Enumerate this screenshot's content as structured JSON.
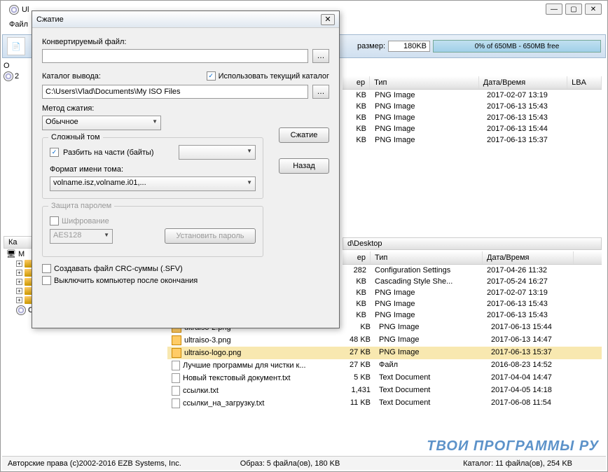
{
  "main_window": {
    "title_prefix": "Ul",
    "menu_file": "Файл",
    "size_label": "размер:",
    "size_value": "180KB",
    "progress_text": "0% of 650MB - 650MB free"
  },
  "upper_list": {
    "hdr_size": "ер",
    "hdr_type": "Тип",
    "hdr_date": "Дата/Время",
    "hdr_lba": "LBA",
    "rows": [
      {
        "size": "KB",
        "type": "PNG Image",
        "date": "2017-02-07 13:19"
      },
      {
        "size": "KB",
        "type": "PNG Image",
        "date": "2017-06-13 15:43"
      },
      {
        "size": "KB",
        "type": "PNG Image",
        "date": "2017-06-13 15:43"
      },
      {
        "size": "KB",
        "type": "PNG Image",
        "date": "2017-06-13 15:44"
      },
      {
        "size": "KB",
        "type": "PNG Image",
        "date": "2017-06-13 15:37"
      }
    ]
  },
  "path_bar": "d\\Desktop",
  "lower_list": {
    "hdr_size": "ер",
    "hdr_type": "Тип",
    "hdr_date": "Дата/Время",
    "rows": [
      {
        "size": "282",
        "type": "Configuration Settings",
        "date": "2017-04-26 11:32"
      },
      {
        "size": "KB",
        "type": "Cascading Style She...",
        "date": "2017-05-24 16:27"
      },
      {
        "size": "KB",
        "type": "PNG Image",
        "date": "2017-02-07 13:19"
      },
      {
        "size": "KB",
        "type": "PNG Image",
        "date": "2017-06-13 15:43"
      },
      {
        "size": "KB",
        "type": "PNG Image",
        "date": "2017-06-13 15:43"
      }
    ]
  },
  "lower_list2": {
    "rows": [
      {
        "name": "ultraiso-2.png",
        "size": "KB",
        "type": "PNG Image",
        "date": "2017-06-13 15:44"
      },
      {
        "name": "ultraiso-3.png",
        "size": "48 KB",
        "type": "PNG Image",
        "date": "2017-06-13 14:47"
      },
      {
        "name": "ultraiso-logo.png",
        "size": "27 KB",
        "type": "PNG Image",
        "date": "2017-06-13 15:37"
      },
      {
        "name": "Лучшие программы для чистки к...",
        "size": "27 KB",
        "type": "Файл",
        "date": "2016-08-23 14:52"
      },
      {
        "name": "Новый текстовый документ.txt",
        "size": "5 KB",
        "type": "Text Document",
        "date": "2017-04-04 14:47"
      },
      {
        "name": "ссылки.txt",
        "size": "1,431",
        "type": "Text Document",
        "date": "2017-04-05 14:18"
      },
      {
        "name": "ссылки_на_загрузку.txt",
        "size": "11 KB",
        "type": "Text Document",
        "date": "2017-06-08 11:54"
      }
    ]
  },
  "tree2": {
    "header": "Ка",
    "root": "M",
    "items": [
      "",
      "",
      "",
      "",
      ""
    ],
    "cd": "CD привод(E:)"
  },
  "dialog": {
    "title": "Сжатие",
    "file_label": "Конвертируемый файл:",
    "file_value": "",
    "output_label": "Каталог вывода:",
    "use_current": "Использовать текущий каталог",
    "output_value": "C:\\Users\\Vlad\\Documents\\My ISO Files",
    "method_label": "Метод сжатия:",
    "method_value": "Обычное",
    "compress_btn": "Сжатие",
    "back_btn": "Назад",
    "complex_legend": "Сложный том",
    "split_label": "Разбить на части (байты)",
    "split_value": "",
    "volname_label": "Формат имени тома:",
    "volname_value": "volname.isz,volname.i01,...",
    "password_legend": "Защита паролем",
    "encrypt_label": "Шифрование",
    "encrypt_method": "AES128",
    "setpass_btn": "Установить пароль",
    "crc_label": "Создавать файл CRC-суммы (.SFV)",
    "shutdown_label": "Выключить компьютер после окончания"
  },
  "status": {
    "copyright": "Авторские права (c)2002-2016 EZB Systems, Inc.",
    "image": "Образ: 5 файла(ов), 180 KB",
    "catalog": "Каталог: 11 файла(ов), 254 KB"
  },
  "watermark": "ТВОИ ПРОГРАММЫ РУ"
}
